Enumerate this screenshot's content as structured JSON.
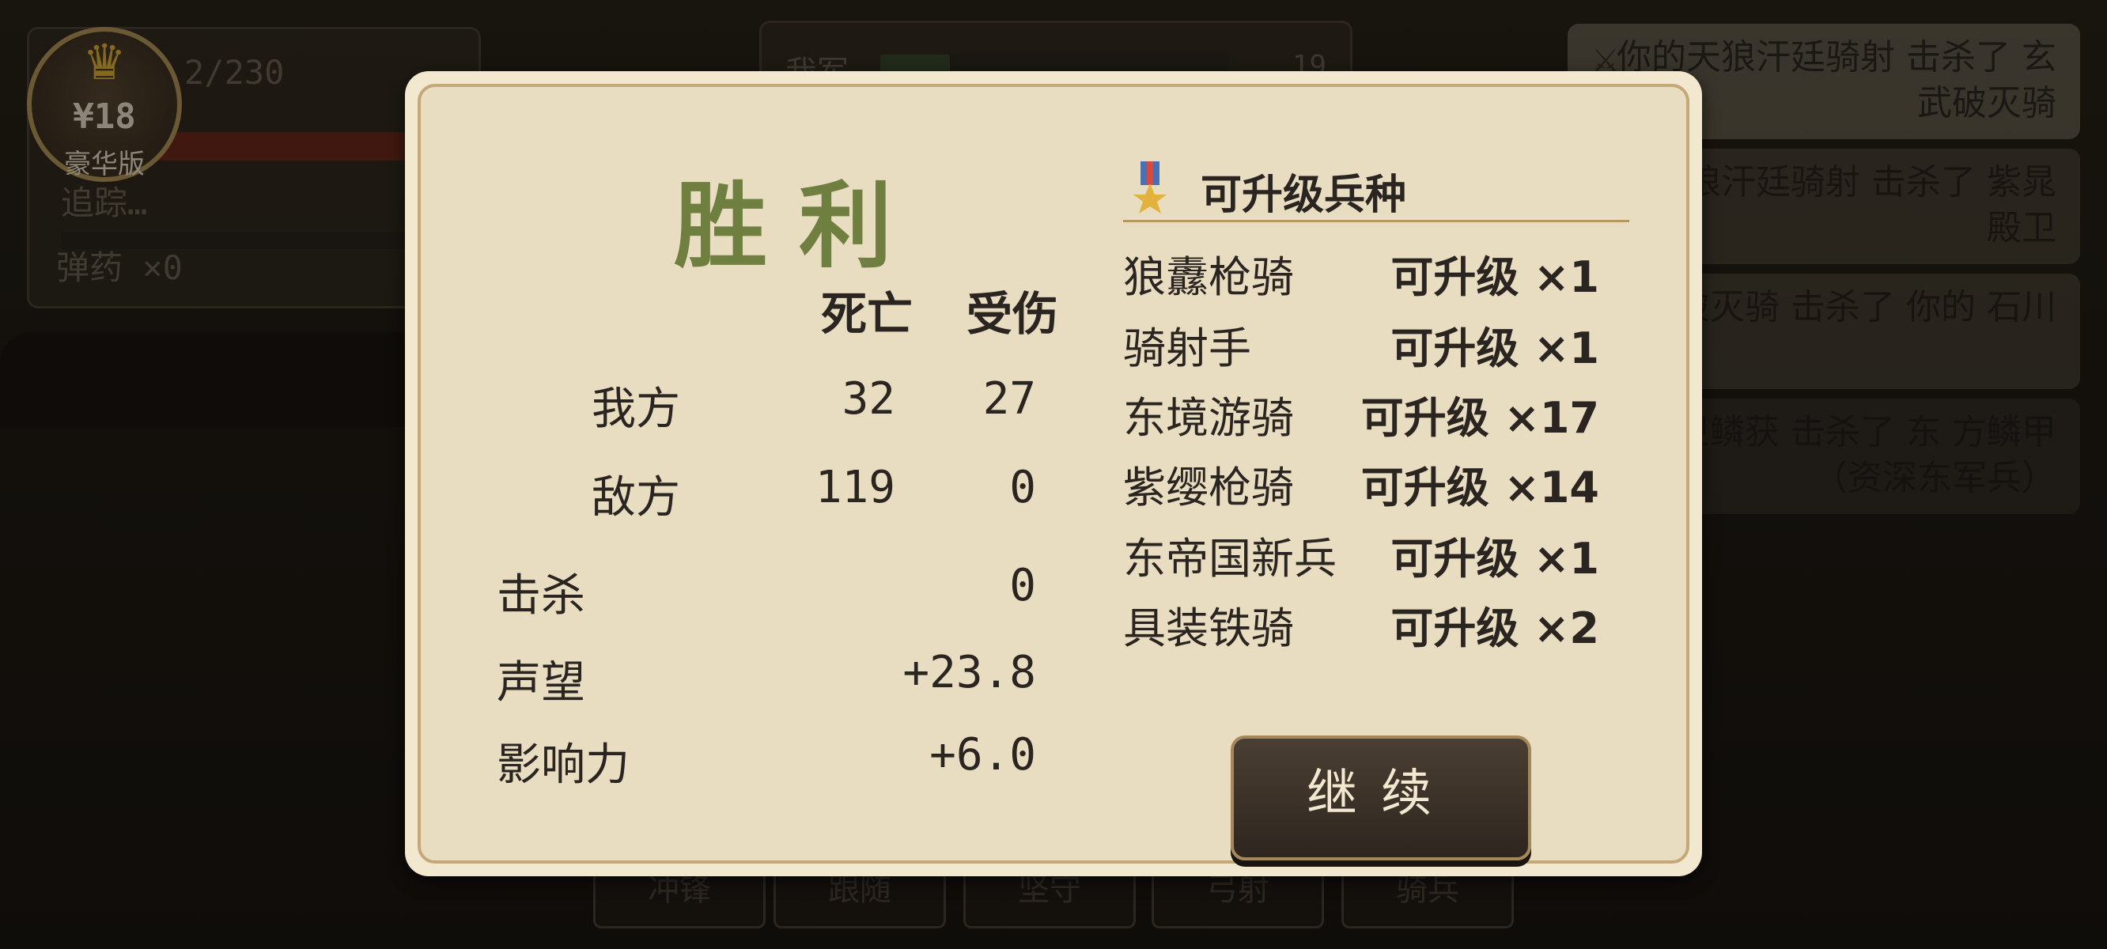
{
  "hud": {
    "hp_text": "2/230",
    "hp_fraction": 0.9,
    "status_text": "追踪…",
    "ammo_text": "弹药 ×0",
    "army_label": "我军",
    "army_fraction": 0.2,
    "army_count": "19"
  },
  "badge": {
    "price": "¥18",
    "edition": "豪华版"
  },
  "kill_feed": [
    {
      "text": "你的天狼汗廷骑射 击杀了 玄武破灭骑"
    },
    {
      "text": "的天狼汗廷骑射 击杀了 紫晁殿卫"
    },
    {
      "text": "武破灭骑 击杀了 你的 石川"
    },
    {
      "text": "亲卫鳞获 击杀了 东 方鳞甲（资深东军兵）"
    }
  ],
  "commands": [
    "冲锋",
    "跟随",
    "坚守",
    "弓射",
    "骑兵"
  ],
  "result": {
    "title": "胜利",
    "col_deaths": "死亡",
    "col_injured": "受伤",
    "own_label": "我方",
    "own_deaths": "32",
    "own_injured": "27",
    "enemy_label": "敌方",
    "enemy_deaths": "119",
    "enemy_injured": "0",
    "kills_label": "击杀",
    "kills_value": "0",
    "renown_label": "声望",
    "renown_value": "+23.8",
    "influence_label": "影响力",
    "influence_value": "+6.0"
  },
  "upgrades": {
    "title": "可升级兵种",
    "items": [
      {
        "name": "狼纛枪骑",
        "status": "可升级 ×1"
      },
      {
        "name": "骑射手",
        "status": "可升级 ×1"
      },
      {
        "name": "东境游骑",
        "status": "可升级 ×17"
      },
      {
        "name": "紫缨枪骑",
        "status": "可升级 ×14"
      },
      {
        "name": "东帝国新兵",
        "status": "可升级 ×1"
      },
      {
        "name": "具装铁骑",
        "status": "可升级 ×2"
      }
    ]
  },
  "continue_label": "继续",
  "colors": {
    "victory": "#6e7f3f",
    "modal_bg": "#e8dcc1",
    "modal_border": "#c4a877",
    "button_bg": "#3a3128"
  }
}
